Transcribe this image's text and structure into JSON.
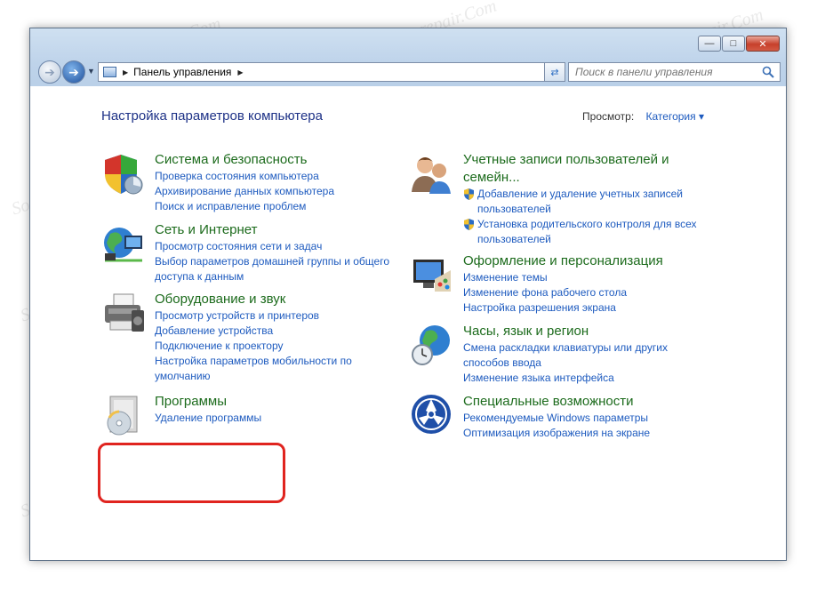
{
  "address": {
    "crumb": "Панель управления",
    "search_placeholder": "Поиск в панели управления"
  },
  "content": {
    "title": "Настройка параметров компьютера",
    "view_by_label": "Просмотр:",
    "view_by_value": "Категория"
  },
  "left_categories": [
    {
      "icon": "security-shield-icon",
      "title": "Система и безопасность",
      "links": [
        "Проверка состояния компьютера",
        "Архивирование данных компьютера",
        "Поиск и исправление проблем"
      ]
    },
    {
      "icon": "network-globe-icon",
      "title": "Сеть и Интернет",
      "links": [
        "Просмотр состояния сети и задач",
        "Выбор параметров домашней группы и общего",
        "доступа к данным"
      ]
    },
    {
      "icon": "printer-icon",
      "title": "Оборудование и звук",
      "links": [
        "Просмотр устройств и принтеров",
        "Добавление устройства",
        "Подключение к проектору",
        "Настройка параметров мобильности по",
        "умолчанию"
      ]
    },
    {
      "icon": "programs-disc-icon",
      "title": "Программы",
      "links": [
        "Удаление программы"
      ]
    }
  ],
  "right_categories": [
    {
      "icon": "users-icon",
      "title_lines": [
        "Учетные записи пользователей и",
        "семейн..."
      ],
      "links": [
        "Добавление и удаление учетных записей",
        "пользователей",
        "Установка родительского контроля для всех",
        "пользователей"
      ]
    },
    {
      "icon": "monitor-palette-icon",
      "title": "Оформление и персонализация",
      "links": [
        "Изменение темы",
        "Изменение фона рабочего стола",
        "Настройка разрешения экрана"
      ]
    },
    {
      "icon": "clock-globe-icon",
      "title": "Часы, язык и регион",
      "links": [
        "Смена раскладки клавиатуры или других",
        "способов ввода",
        "Изменение языка интерфейса"
      ]
    },
    {
      "icon": "accessibility-icon",
      "title": "Специальные возможности",
      "links": [
        "Рекомендуемые Windows параметры",
        "Оптимизация изображения на экране"
      ]
    }
  ],
  "watermark_text": "Soringpcrepair.Com",
  "colors": {
    "title_blue": "#1e3287",
    "category_green": "#1c6b1c",
    "link_blue": "#1e5bbf",
    "highlight_red": "#e0241f"
  }
}
